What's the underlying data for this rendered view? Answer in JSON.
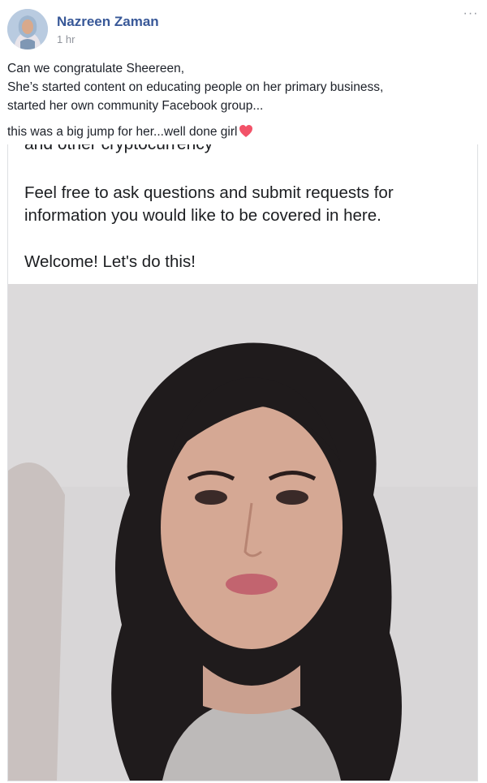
{
  "post": {
    "author": "Nazreen Zaman",
    "time": "1 hr",
    "more_icon": "···",
    "text_lines": [
      "Can we congratulate Sheereen,",
      "She’s started content on educating people on her primary business,",
      "started her own community Facebook group...",
      "this was a big jump for her...well done girl"
    ],
    "emoji": "heart-icon"
  },
  "attachment": {
    "cut_line": "and other cryptocurrency",
    "paragraph": "Feel free to ask questions and submit requests for information you would like to be covered in here.",
    "welcome": "Welcome! Let's do this!"
  },
  "colors": {
    "author_blue": "#385898",
    "meta_grey": "#90949c",
    "heart_pink": "#f25268",
    "photo_background": "#d8d6d7"
  }
}
